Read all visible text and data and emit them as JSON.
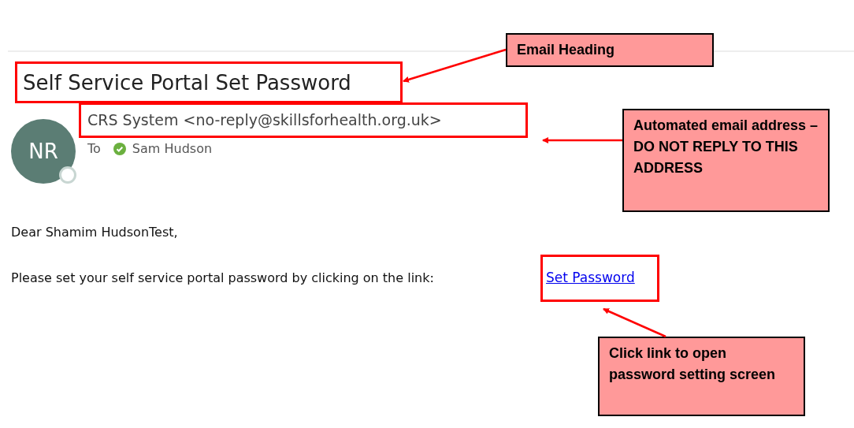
{
  "email": {
    "subject": "Self Service Portal Set Password",
    "avatar_initials": "NR",
    "sender": "CRS System <no-reply@skillsforhealth.org.uk>",
    "to_label": "To",
    "recipient": "Sam Hudson",
    "greeting": "Dear Shamim HudsonTest,",
    "body": "Please set your self service portal password by clicking on the link:",
    "link": "Set Password"
  },
  "annotations": [
    {
      "text": "Email Heading"
    },
    {
      "text": "Automated email address – DO NOT REPLY TO THIS ADDRESS"
    },
    {
      "text": "Click link to open password setting screen"
    }
  ]
}
